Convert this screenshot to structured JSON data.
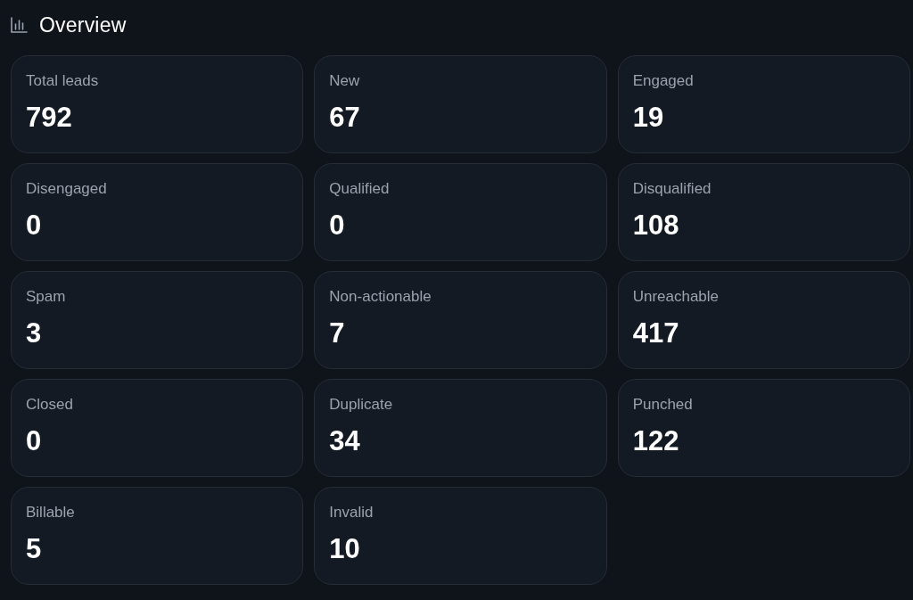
{
  "header": {
    "title": "Overview"
  },
  "stats": [
    {
      "label": "Total leads",
      "value": "792"
    },
    {
      "label": "New",
      "value": "67"
    },
    {
      "label": "Engaged",
      "value": "19"
    },
    {
      "label": "Disengaged",
      "value": "0"
    },
    {
      "label": "Qualified",
      "value": "0"
    },
    {
      "label": "Disqualified",
      "value": "108"
    },
    {
      "label": "Spam",
      "value": "3"
    },
    {
      "label": "Non-actionable",
      "value": "7"
    },
    {
      "label": "Unreachable",
      "value": "417"
    },
    {
      "label": "Closed",
      "value": "0"
    },
    {
      "label": "Duplicate",
      "value": "34"
    },
    {
      "label": "Punched",
      "value": "122"
    },
    {
      "label": "Billable",
      "value": "5"
    },
    {
      "label": "Invalid",
      "value": "10"
    }
  ]
}
